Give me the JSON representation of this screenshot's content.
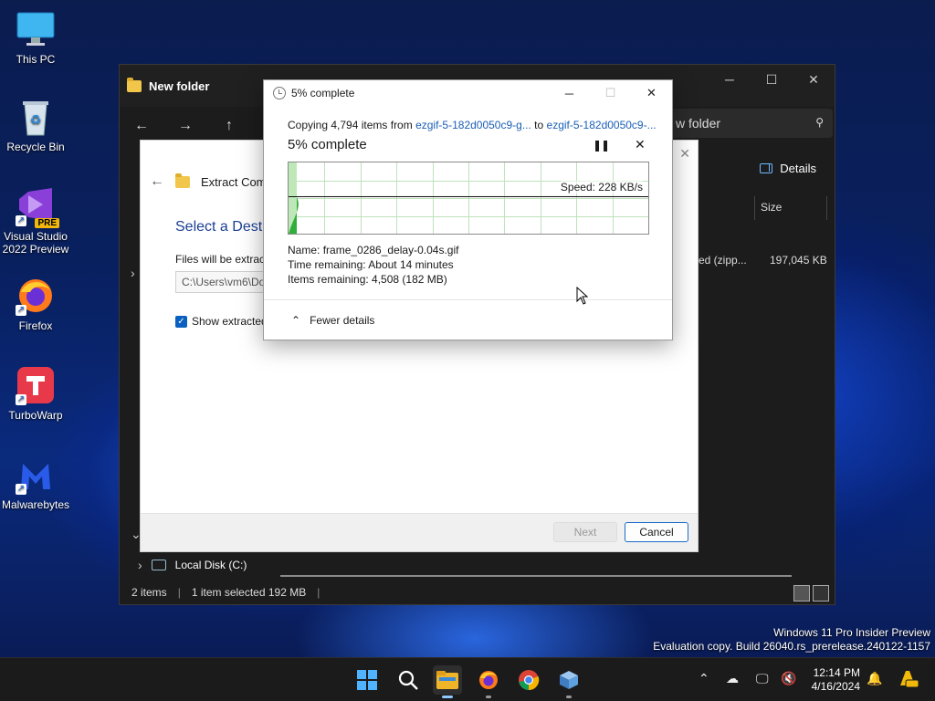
{
  "desktop": {
    "icons": [
      {
        "label": "This PC"
      },
      {
        "label": "Recycle Bin"
      },
      {
        "label": "Visual Studio 2022 Preview",
        "badge": "PRE"
      },
      {
        "label": "Firefox"
      },
      {
        "label": "TurboWarp"
      },
      {
        "label": "Malwarebytes"
      }
    ],
    "watermark_line1": "Windows 11 Pro Insider Preview",
    "watermark_line2": "Evaluation copy. Build 26040.rs_prerelease.240122-1157"
  },
  "explorer": {
    "title": "New folder",
    "search_text": "w folder",
    "details_label": "Details",
    "size_column": "Size",
    "row_type": "ed (zipp...",
    "row_size": "197,045 KB",
    "nav_local_disk": "Local Disk (C:)",
    "status_items": "2 items",
    "status_selected": "1 item selected  192 MB"
  },
  "extract_dialog": {
    "title": "Extract Compre",
    "heading": "Select a Destin",
    "files_label": "Files will be extract",
    "path_value": "C:\\Users\\vm6\\Do",
    "checkbox_label": "Show extracted",
    "next_label": "Next",
    "cancel_label": "Cancel"
  },
  "copy_dialog": {
    "window_title": "5% complete",
    "copying_prefix": "Copying 4,794 items from",
    "source": "ezgif-5-182d0050c9-g...",
    "to_word": "to",
    "destination": "ezgif-5-182d0050c9-...",
    "percent_label": "5% complete",
    "progress_fraction": 0.05,
    "speed_label": "Speed: 228 KB/s",
    "name_label": "Name:",
    "name_value": "frame_0286_delay-0.04s.gif",
    "time_label": "Time remaining:",
    "time_value": "About 14 minutes",
    "items_label": "Items remaining:",
    "items_value": "4,508 (182 MB)",
    "fewer_details": "Fewer details",
    "graph_color": "#2fae3a",
    "graph_fill": "#bfe8b9"
  },
  "taskbar": {
    "apps": [
      "start-icon",
      "search-icon",
      "file-explorer-icon",
      "firefox-icon",
      "chrome-icon",
      "app-icon"
    ],
    "time": "12:14 PM",
    "date": "4/16/2024"
  }
}
